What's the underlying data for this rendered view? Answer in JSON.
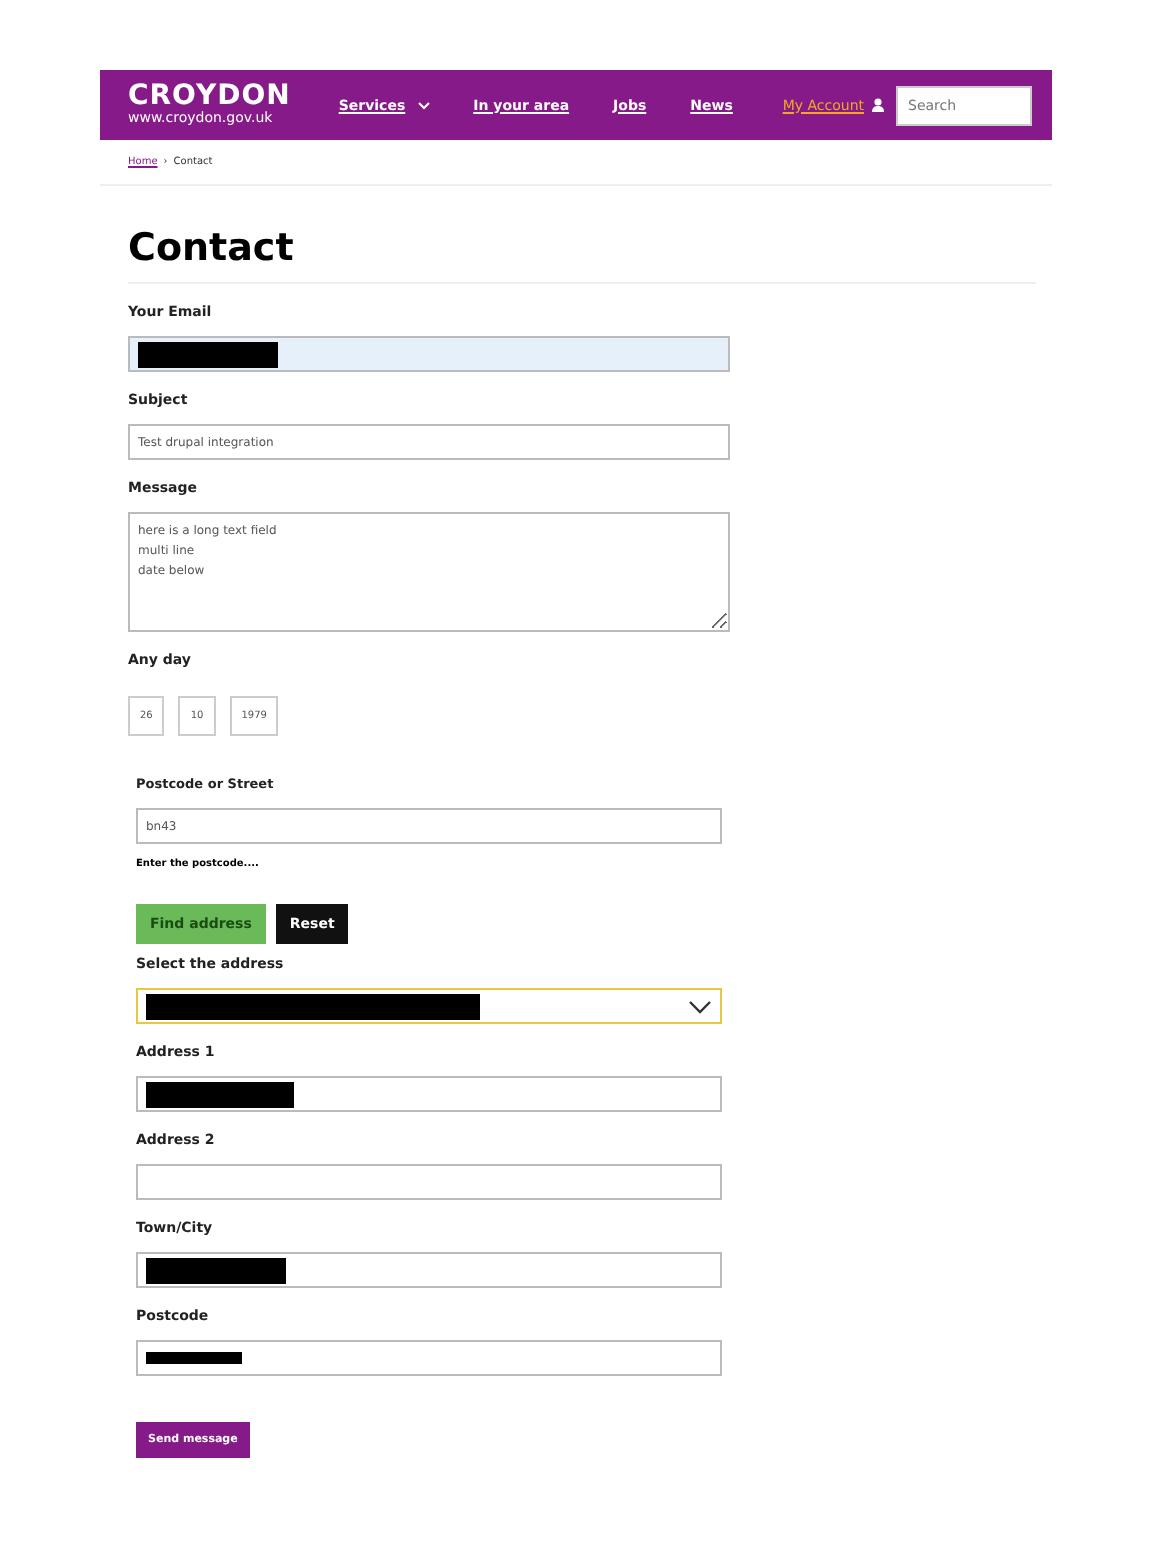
{
  "header": {
    "logo_name": "CROYDON",
    "logo_url": "www.croydon.gov.uk",
    "nav": [
      {
        "label": "Services",
        "dropdown": true
      },
      {
        "label": "In your area",
        "dropdown": false
      },
      {
        "label": "Jobs",
        "dropdown": false
      },
      {
        "label": "News",
        "dropdown": false
      }
    ],
    "account_link": "My Account",
    "search": {
      "placeholder": "Search"
    }
  },
  "breadcrumb_separator": "›",
  "breadcrumb": [
    {
      "label": "Home",
      "link": true
    },
    {
      "label": "Contact",
      "link": false
    }
  ],
  "title": "Contact",
  "fields": [
    {
      "kind": "text",
      "label": "Your Email",
      "redacted": true,
      "focused": true
    },
    {
      "kind": "text",
      "label": "Subject",
      "value": "Test drupal integration",
      "redacted": false,
      "focused": false
    },
    {
      "kind": "textarea",
      "label": "Message",
      "lines": [
        "here is a long text field",
        "multi line",
        "date below"
      ]
    },
    {
      "kind": "date",
      "label": "Any day",
      "parts": [
        "26",
        "10",
        "1979"
      ]
    }
  ],
  "address_lookup": {
    "label": "Postcode or Street",
    "value": "bn43",
    "hint": "Enter the postcode....",
    "find_button": "Find address",
    "reset_button": "Reset",
    "fields": [
      {
        "kind": "select",
        "label": "Select the address",
        "redacted": true,
        "focused": true
      },
      {
        "kind": "text",
        "label": "Address 1",
        "redacted": true,
        "focused": false
      },
      {
        "kind": "text",
        "label": "Address 2",
        "redacted": false,
        "focused": false
      },
      {
        "kind": "text",
        "label": "Town/City",
        "redacted": true,
        "focused": false
      },
      {
        "kind": "text",
        "label": "Postcode",
        "redacted": true,
        "focused": false
      }
    ]
  },
  "submit_button": "Send message"
}
